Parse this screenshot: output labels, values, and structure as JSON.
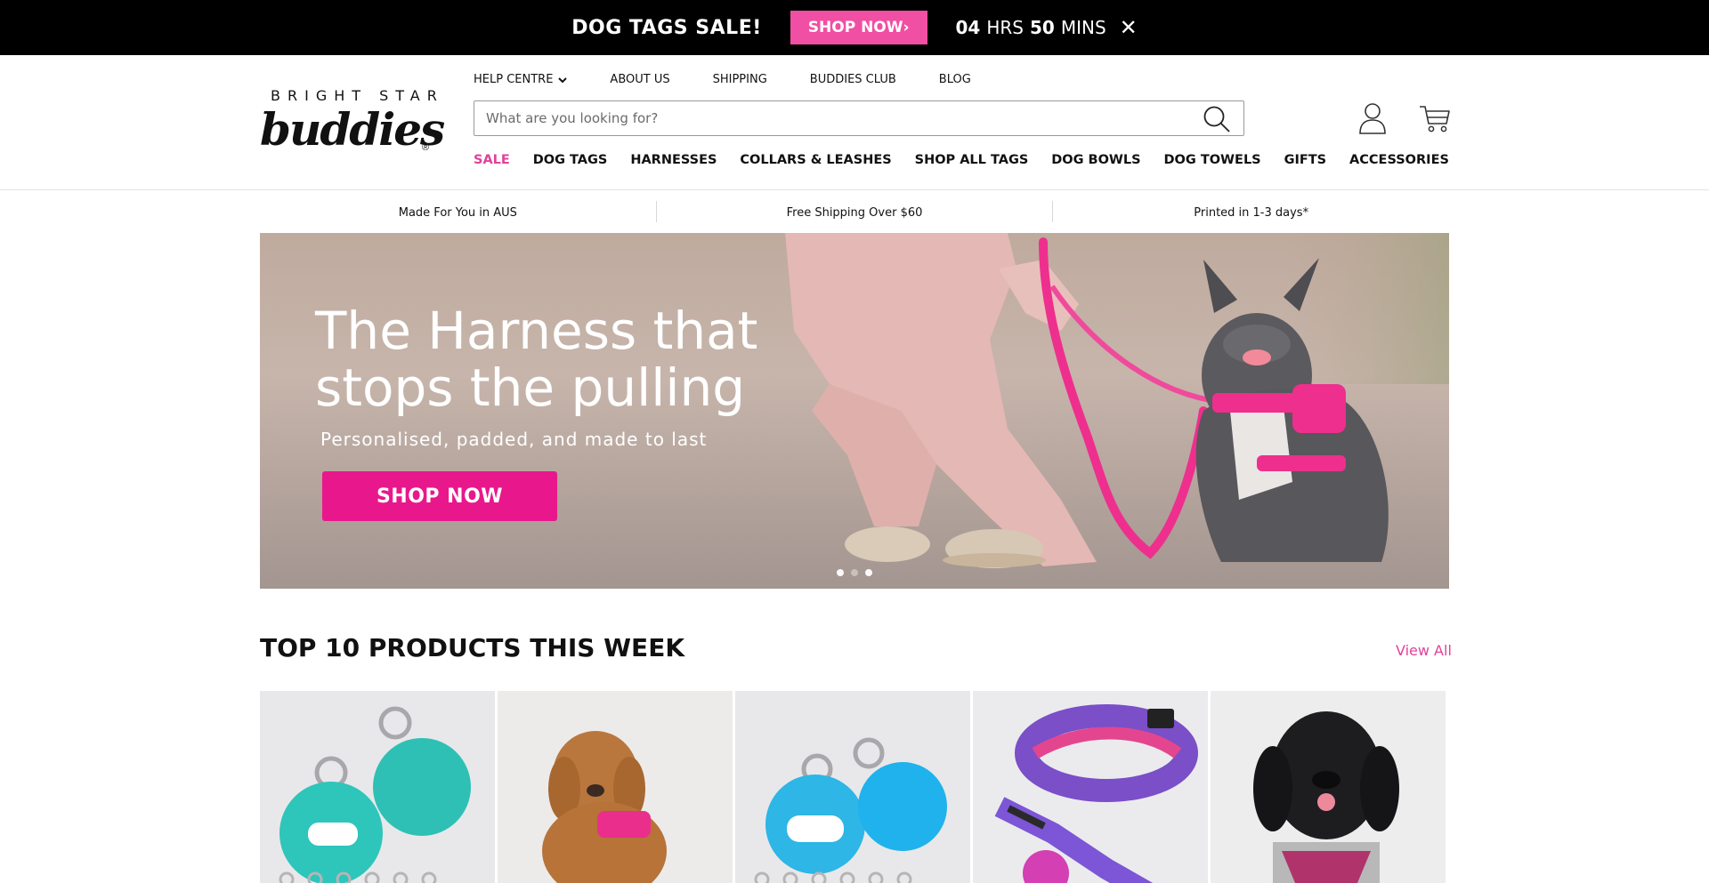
{
  "promo": {
    "title": "DOG TAGS SALE!",
    "button": "SHOP NOW›",
    "hours_value": "04",
    "hours_unit": "HRS",
    "mins_value": "50",
    "mins_unit": "MINS",
    "close_icon": "✕"
  },
  "logo": {
    "top": "BRIGHT STAR",
    "script": "buddies",
    "reg": "®"
  },
  "topnav": {
    "help": "HELP CENTRE",
    "about": "ABOUT US",
    "shipping": "SHIPPING",
    "club": "BUDDIES CLUB",
    "blog": "BLOG"
  },
  "search": {
    "placeholder": "What are you looking for?"
  },
  "mainnav": {
    "sale": "SALE",
    "dog_tags": "DOG TAGS",
    "harnesses": "HARNESSES",
    "collars": "COLLARS & LEASHES",
    "all_tags": "SHOP ALL TAGS",
    "bowls": "DOG BOWLS",
    "towels": "DOG TOWELS",
    "gifts": "GIFTS",
    "accessories": "ACCESSORIES"
  },
  "usp": {
    "made": "Made For You in AUS",
    "shipping": "Free Shipping Over $60",
    "printed": "Printed in 1-3 days*"
  },
  "hero": {
    "title_line1": "The Harness that",
    "title_line2": "stops the pulling",
    "subtitle": "Personalised, padded, and made to last",
    "button": "SHOP NOW"
  },
  "section": {
    "title": "TOP 10 PRODUCTS THIS WEEK",
    "view_all": "View All"
  },
  "colors": {
    "accent_pink": "#e8188c",
    "link_pink": "#e0429a",
    "promo_button": "#f04fa3",
    "promo_bar": "#000000"
  },
  "icons": [
    "close-icon",
    "chevron-down-icon",
    "search-icon",
    "account-icon",
    "cart-icon"
  ]
}
